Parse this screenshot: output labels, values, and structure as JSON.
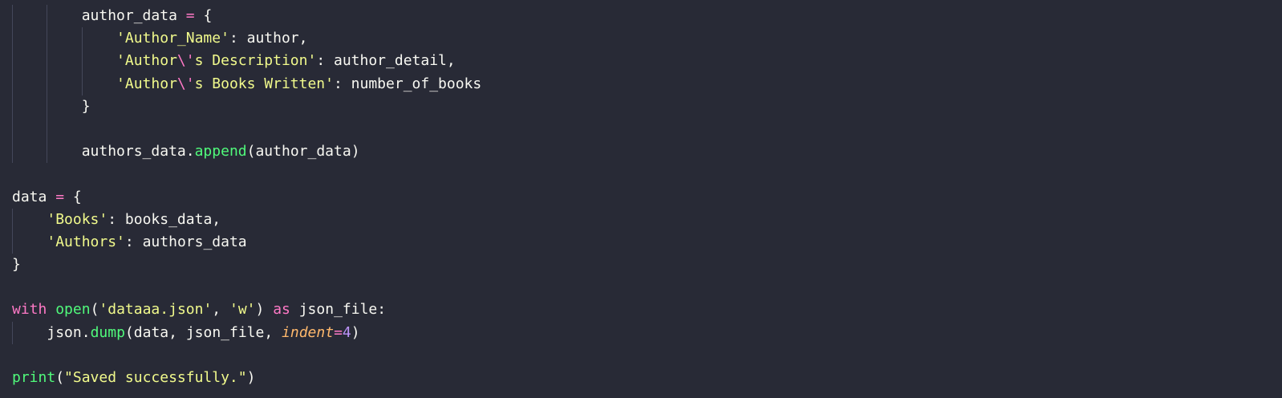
{
  "editor": {
    "language": "python",
    "theme": {
      "background": "#282a36",
      "foreground": "#f8f8f2",
      "keyword": "#ff79c6",
      "string": "#f1fa8c",
      "function": "#50fa7b",
      "parameter": "#ffb86c",
      "number": "#bd93f9",
      "indent_guide": "#44475a"
    },
    "lines": [
      {
        "indent": 2,
        "tokens": [
          {
            "type": "var",
            "text": "author_data"
          },
          {
            "type": "punc",
            "text": " "
          },
          {
            "type": "op",
            "text": "="
          },
          {
            "type": "punc",
            "text": " {"
          }
        ]
      },
      {
        "indent": 3,
        "tokens": [
          {
            "type": "str",
            "text": "'Author_Name'"
          },
          {
            "type": "punc",
            "text": ": "
          },
          {
            "type": "var",
            "text": "author"
          },
          {
            "type": "punc",
            "text": ","
          }
        ]
      },
      {
        "indent": 3,
        "tokens": [
          {
            "type": "str",
            "text": "'Author"
          },
          {
            "type": "esc",
            "text": "\\'"
          },
          {
            "type": "str",
            "text": "s Description'"
          },
          {
            "type": "punc",
            "text": ": "
          },
          {
            "type": "var",
            "text": "author_detail"
          },
          {
            "type": "punc",
            "text": ","
          }
        ]
      },
      {
        "indent": 3,
        "tokens": [
          {
            "type": "str",
            "text": "'Author"
          },
          {
            "type": "esc",
            "text": "\\'"
          },
          {
            "type": "str",
            "text": "s Books Written'"
          },
          {
            "type": "punc",
            "text": ": "
          },
          {
            "type": "var",
            "text": "number_of_books"
          }
        ]
      },
      {
        "indent": 2,
        "tokens": [
          {
            "type": "punc",
            "text": "}"
          }
        ]
      },
      {
        "indent": 2,
        "guides_only": true,
        "tokens": []
      },
      {
        "indent": 2,
        "tokens": [
          {
            "type": "var",
            "text": "authors_data"
          },
          {
            "type": "punc",
            "text": "."
          },
          {
            "type": "func",
            "text": "append"
          },
          {
            "type": "punc",
            "text": "("
          },
          {
            "type": "var",
            "text": "author_data"
          },
          {
            "type": "punc",
            "text": ")"
          }
        ]
      },
      {
        "indent": 0,
        "tokens": []
      },
      {
        "indent": 0,
        "tokens": [
          {
            "type": "var",
            "text": "data"
          },
          {
            "type": "punc",
            "text": " "
          },
          {
            "type": "op",
            "text": "="
          },
          {
            "type": "punc",
            "text": " {"
          }
        ]
      },
      {
        "indent": 1,
        "tokens": [
          {
            "type": "str",
            "text": "'Books'"
          },
          {
            "type": "punc",
            "text": ": "
          },
          {
            "type": "var",
            "text": "books_data"
          },
          {
            "type": "punc",
            "text": ","
          }
        ]
      },
      {
        "indent": 1,
        "tokens": [
          {
            "type": "str",
            "text": "'Authors'"
          },
          {
            "type": "punc",
            "text": ": "
          },
          {
            "type": "var",
            "text": "authors_data"
          }
        ]
      },
      {
        "indent": 0,
        "tokens": [
          {
            "type": "punc",
            "text": "}"
          }
        ]
      },
      {
        "indent": 0,
        "tokens": []
      },
      {
        "indent": 0,
        "tokens": [
          {
            "type": "kw",
            "text": "with"
          },
          {
            "type": "punc",
            "text": " "
          },
          {
            "type": "func",
            "text": "open"
          },
          {
            "type": "punc",
            "text": "("
          },
          {
            "type": "str",
            "text": "'dataaa.json'"
          },
          {
            "type": "punc",
            "text": ", "
          },
          {
            "type": "str",
            "text": "'w'"
          },
          {
            "type": "punc",
            "text": ") "
          },
          {
            "type": "kw",
            "text": "as"
          },
          {
            "type": "punc",
            "text": " "
          },
          {
            "type": "var",
            "text": "json_file"
          },
          {
            "type": "punc",
            "text": ":"
          }
        ]
      },
      {
        "indent": 1,
        "tokens": [
          {
            "type": "var",
            "text": "json"
          },
          {
            "type": "punc",
            "text": "."
          },
          {
            "type": "func",
            "text": "dump"
          },
          {
            "type": "punc",
            "text": "("
          },
          {
            "type": "var",
            "text": "data"
          },
          {
            "type": "punc",
            "text": ", "
          },
          {
            "type": "var",
            "text": "json_file"
          },
          {
            "type": "punc",
            "text": ", "
          },
          {
            "type": "param",
            "text": "indent"
          },
          {
            "type": "op",
            "text": "="
          },
          {
            "type": "num",
            "text": "4"
          },
          {
            "type": "punc",
            "text": ")"
          }
        ]
      },
      {
        "indent": 0,
        "tokens": []
      },
      {
        "indent": 0,
        "tokens": [
          {
            "type": "func",
            "text": "print"
          },
          {
            "type": "punc",
            "text": "("
          },
          {
            "type": "str",
            "text": "\"Saved successfully.\""
          },
          {
            "type": "punc",
            "text": ")"
          }
        ]
      }
    ]
  }
}
